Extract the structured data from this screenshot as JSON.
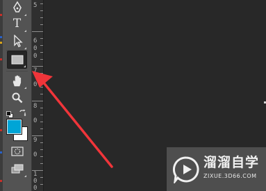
{
  "toolbar": {
    "tools": [
      {
        "name": "pen-tool",
        "icon": "pen-icon"
      },
      {
        "name": "type-tool",
        "icon": "type-icon",
        "glyph": "T"
      },
      {
        "name": "path-selection-tool",
        "icon": "path-selection-arrow-icon"
      },
      {
        "name": "rectangle-tool",
        "icon": "rectangle-icon",
        "active": true
      },
      {
        "name": "hand-tool",
        "icon": "hand-icon"
      },
      {
        "name": "zoom-tool",
        "icon": "magnifier-icon"
      },
      {
        "name": "default-colors",
        "icon": "default-colors-icon"
      },
      {
        "name": "swap-colors",
        "icon": "swap-arrow-icon"
      },
      {
        "name": "quick-mask",
        "icon": "quick-mask-icon"
      },
      {
        "name": "screen-mode",
        "icon": "screen-mode-icon"
      }
    ],
    "foreground_color": "#00a5d6",
    "background_color": "#ffffff"
  },
  "ruler": {
    "digits": [
      "5",
      "6",
      "0",
      "0",
      "7",
      "0",
      "8",
      "0",
      "9",
      "0",
      "1",
      "0",
      "0"
    ]
  },
  "annotation": {
    "type": "arrow",
    "color": "#f0353a",
    "target": "rectangle-tool"
  },
  "watermark": {
    "logo_icon": "play-bubble-logo-icon",
    "title": "溜溜自学",
    "subtitle": "ZIXUE.3D66.COM"
  },
  "colors": {
    "toolbar_bg": "#535353",
    "canvas_bg": "#282828",
    "ruler_bg": "#2f2f2f"
  }
}
